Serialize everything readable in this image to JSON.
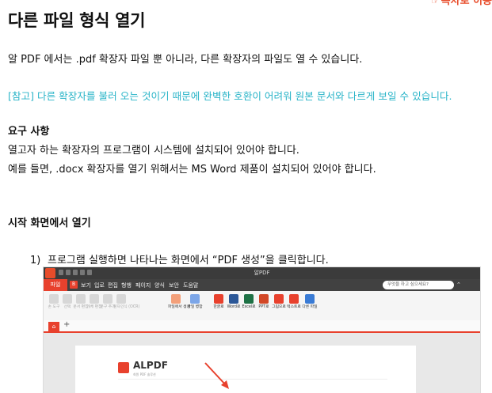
{
  "toc_link": {
    "icon": "pointing-hand-icon",
    "label": "목차로 이동",
    "color": "#e84c2a"
  },
  "heading": "다른 파일 형식 열기",
  "intro": "알 PDF 에서는 .pdf 확장자 파일 뿐 아니라, 다른 확장자의 파일도 열 수 있습니다.",
  "note": "[참고] 다른 확장자를 불러 오는 것이기 때문에 완벽한 호환이 어려워 원본 문서와 다르게 보일 수 있습니다.",
  "note_color": "#29b4c8",
  "requirements": {
    "heading": "요구 사항",
    "line1": "열고자 하는 확장자의 프로그램이 시스템에 설치되어 있어야 합니다.",
    "line2": "예를 들면, .docx 확장자를 열기 위해서는 MS Word 제품이 설치되어 있어야 합니다."
  },
  "start_section": {
    "heading": "시작 화면에서 열기",
    "step_number": "1)",
    "step_text": "프로그램 실행하면 나타나는 화면에서 “PDF 생성”을 클릭합니다."
  },
  "screenshot": {
    "window_title": "알PDF",
    "menu": {
      "file_tab": "파일",
      "badge": "B",
      "items": [
        "보기",
        "입로",
        "편집",
        "형행",
        "페이지",
        "양식",
        "보안",
        "도움말"
      ]
    },
    "search_placeholder": "무엇을 하고 싶으세요?",
    "ribbon": [
      {
        "label": "손 도구",
        "icon": "hand-tool-icon",
        "color": "#d7d7d7",
        "active": false
      },
      {
        "label": "선택",
        "icon": "select-icon",
        "color": "#d7d7d7",
        "active": false
      },
      {
        "label": "문서 편집",
        "icon": "doc-edit-icon",
        "color": "#d7d7d7",
        "active": false
      },
      {
        "label": "개체 편집",
        "icon": "object-edit-icon",
        "color": "#d7d7d7",
        "active": false
      },
      {
        "label": "문구 추가",
        "icon": "add-text-icon",
        "color": "#d7d7d7",
        "active": false
      },
      {
        "label": "문자인식 (OCR)",
        "icon": "ocr-icon",
        "color": "#d7d7d7",
        "active": false
      },
      {
        "label": "파일에서 생성",
        "icon": "create-from-file-icon",
        "color": "#f3a07a",
        "active": true
      },
      {
        "label": "파일 병합",
        "icon": "merge-icon",
        "color": "#7ca6e8",
        "active": true
      },
      {
        "label": "한글로",
        "icon": "hwp-icon",
        "color": "#e8412d",
        "active": true
      },
      {
        "label": "Word로",
        "icon": "word-icon",
        "color": "#2b5797",
        "active": true
      },
      {
        "label": "Excel로",
        "icon": "excel-icon",
        "color": "#1e7145",
        "active": true
      },
      {
        "label": "PPT로",
        "icon": "ppt-icon",
        "color": "#d24726",
        "active": true
      },
      {
        "label": "그림으로",
        "icon": "image-icon",
        "color": "#e8412d",
        "active": true
      },
      {
        "label": "텍스트로",
        "icon": "text-icon",
        "color": "#e8412d",
        "active": true
      },
      {
        "label": "다른 파일",
        "icon": "other-file-icon",
        "color": "#3a7bd5",
        "active": true
      }
    ],
    "home_tab_icon": "home-icon",
    "new_tab_icon": "plus-icon",
    "brand": "ALPDF",
    "brand_sub": "회원 PDF 솔루션",
    "accent": "#e8412d"
  }
}
